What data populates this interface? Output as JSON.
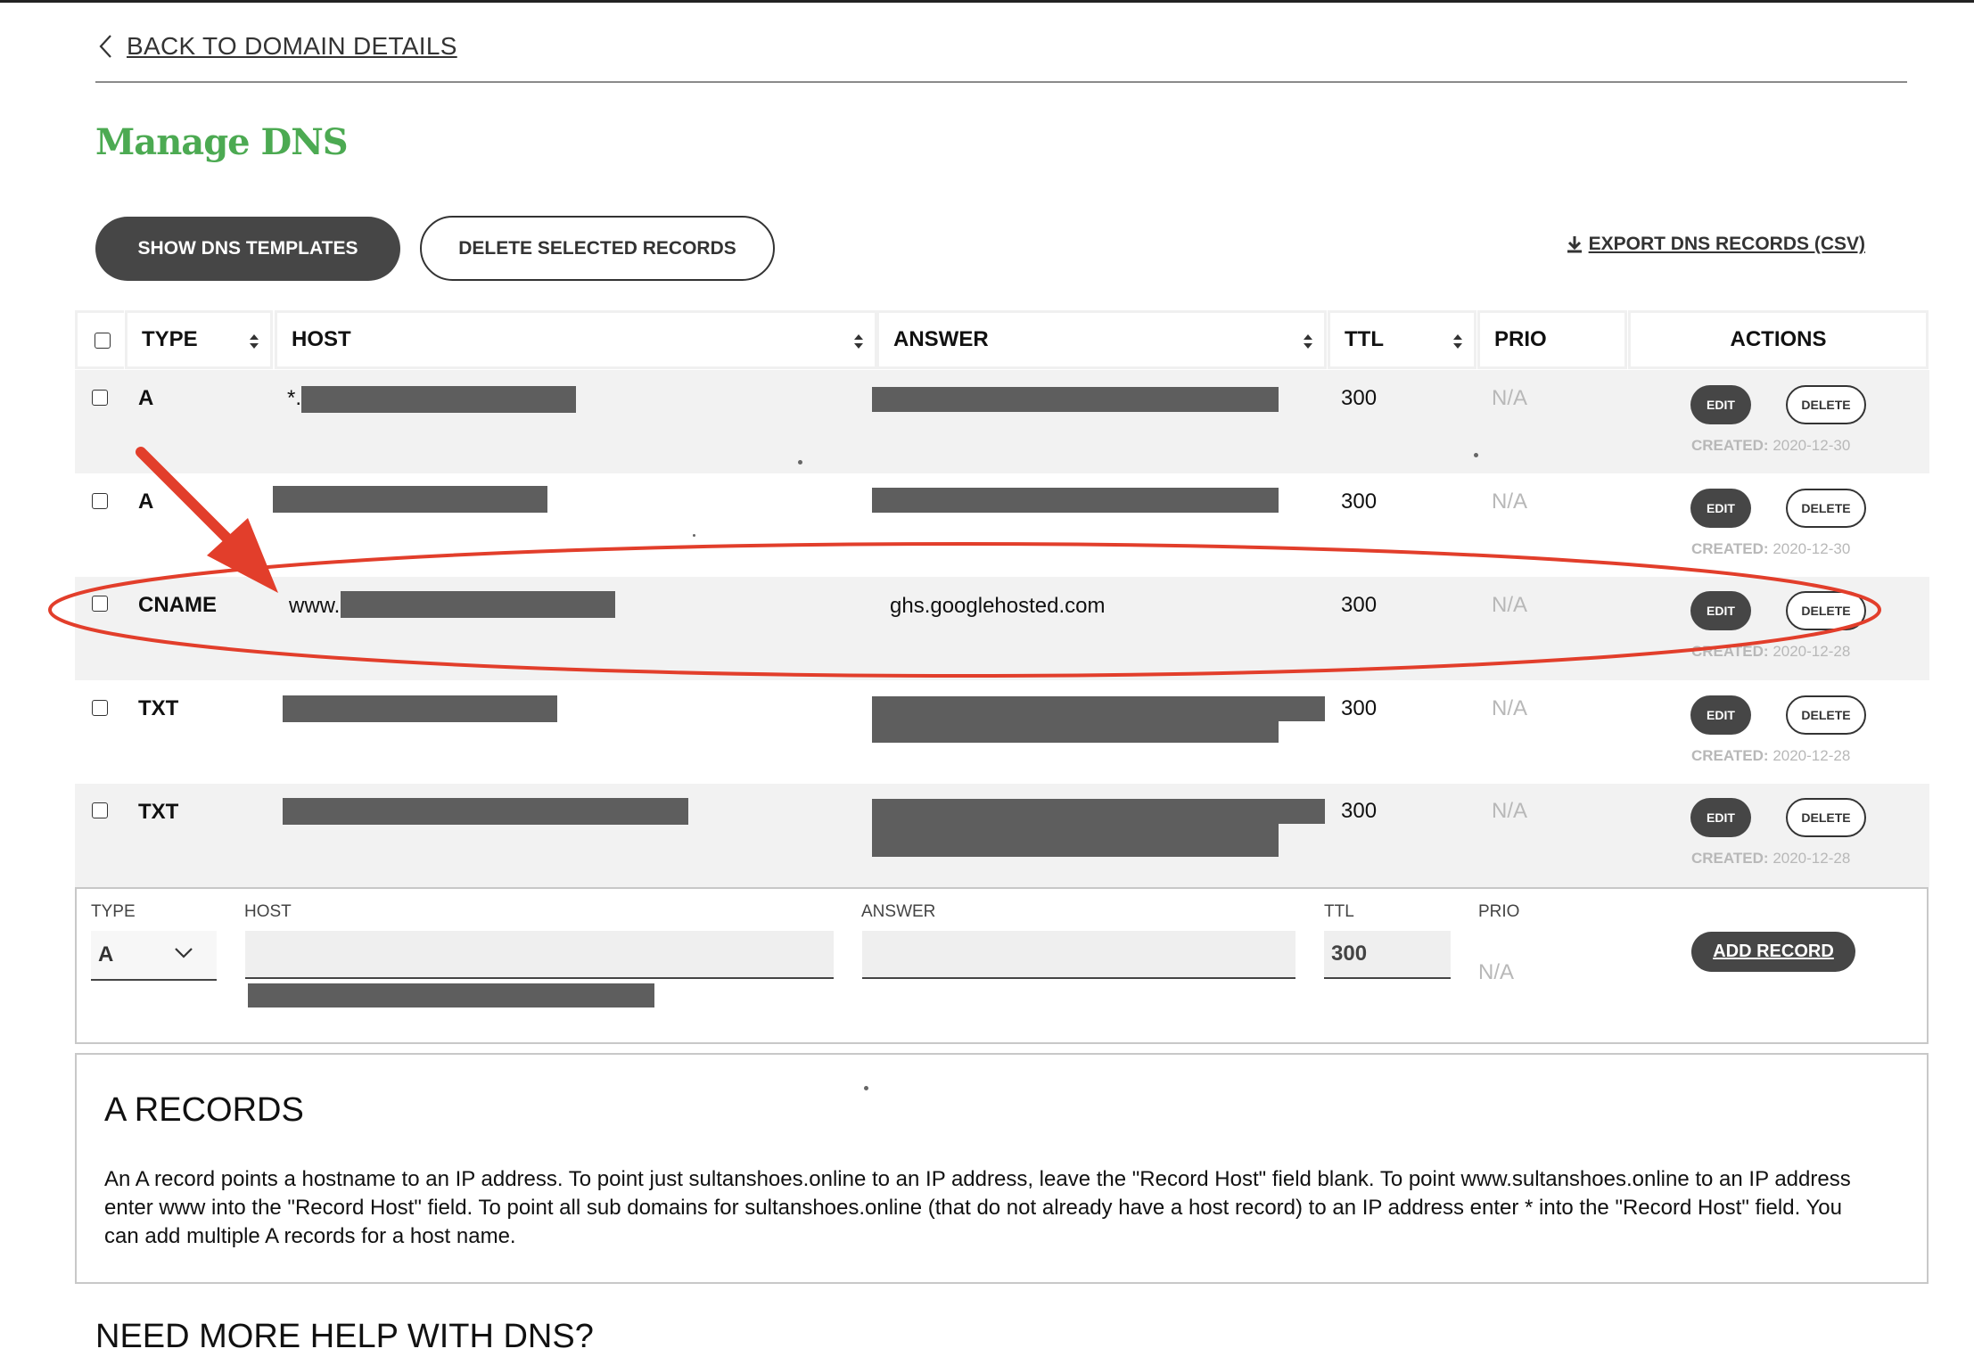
{
  "nav": {
    "back_label": "BACK TO DOMAIN DETAILS"
  },
  "page": {
    "title": "Manage DNS"
  },
  "toolbar": {
    "show_templates": "SHOW DNS TEMPLATES",
    "delete_selected": "DELETE SELECTED RECORDS",
    "export": "EXPORT DNS RECORDS (CSV)"
  },
  "table": {
    "headers": {
      "type": "TYPE",
      "host": "HOST",
      "answer": "ANSWER",
      "ttl": "TTL",
      "prio": "PRIO",
      "actions": "ACTIONS"
    },
    "rows": [
      {
        "type": "A",
        "host_prefix": "*.",
        "answer": "",
        "ttl": "300",
        "prio": "N/A",
        "created_label": "CREATED:",
        "created": "2020-12-30"
      },
      {
        "type": "A",
        "host_prefix": "",
        "answer": "",
        "ttl": "300",
        "prio": "N/A",
        "created_label": "CREATED:",
        "created": "2020-12-30"
      },
      {
        "type": "CNAME",
        "host_prefix": "www.",
        "answer": "ghs.googlehosted.com",
        "ttl": "300",
        "prio": "N/A",
        "created_label": "CREATED:",
        "created": "2020-12-28"
      },
      {
        "type": "TXT",
        "host_prefix": "",
        "answer": "",
        "ttl": "300",
        "prio": "N/A",
        "created_label": "CREATED:",
        "created": "2020-12-28"
      },
      {
        "type": "TXT",
        "host_prefix": "",
        "answer": "",
        "ttl": "300",
        "prio": "N/A",
        "created_label": "CREATED:",
        "created": "2020-12-28"
      }
    ],
    "edit_label": "EDIT",
    "delete_label": "DELETE"
  },
  "add_form": {
    "type_label": "TYPE",
    "host_label": "HOST",
    "answer_label": "ANSWER",
    "ttl_label": "TTL",
    "prio_label": "PRIO",
    "type_value": "A",
    "ttl_value": "300",
    "prio_value": "N/A",
    "add_button": "ADD RECORD"
  },
  "info": {
    "title": "A RECORDS",
    "body": "An A record points a hostname to an IP address. To point just sultanshoes.online to an IP address, leave the \"Record Host\" field blank. To point www.sultanshoes.online to an IP address enter www into the \"Record Host\" field. To point all sub domains for sultanshoes.online (that do not already have a host record) to an IP address enter * into the \"Record Host\" field. You can add multiple A records for a host name."
  },
  "help": {
    "title": "NEED MORE HELP WITH DNS?"
  },
  "colors": {
    "brand_green": "#4caa52",
    "button_dark": "#464646",
    "annotation_red": "#e23e2b",
    "redaction": "#5e5e5e"
  },
  "icons": [
    "chevron-left-icon",
    "download-icon",
    "sort-icon",
    "chevron-down-icon"
  ]
}
